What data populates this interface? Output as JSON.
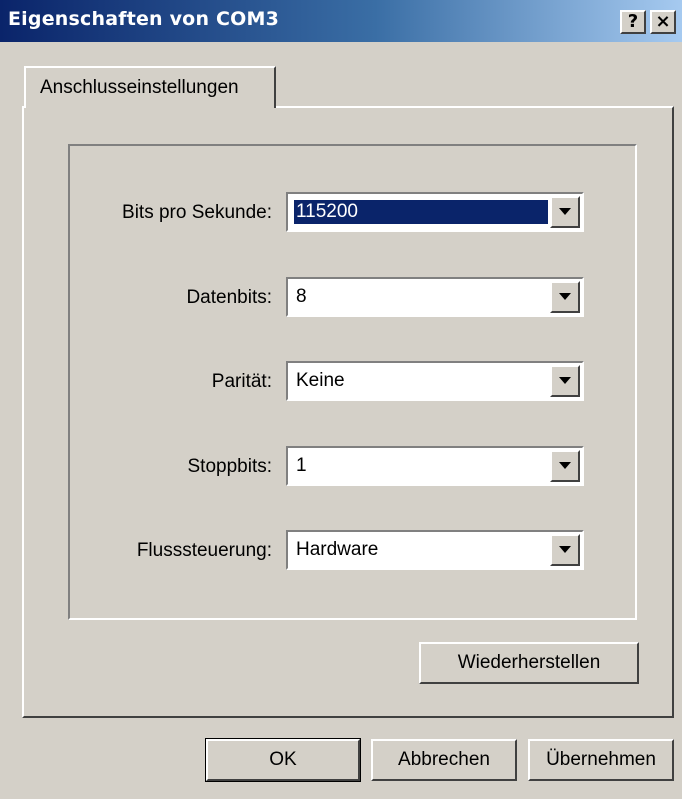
{
  "window": {
    "title": "Eigenschaften von COM3",
    "help_label": "?",
    "close_label": "×"
  },
  "tabs": [
    {
      "label": "Anschlusseinstellungen",
      "selected": true
    }
  ],
  "settings": [
    {
      "label": "Bits pro Sekunde:",
      "value": "115200",
      "focused": true
    },
    {
      "label": "Datenbits:",
      "value": "8"
    },
    {
      "label": "Parität:",
      "value": "Keine"
    },
    {
      "label": "Stoppbits:",
      "value": "1"
    },
    {
      "label": "Flusssteuerung:",
      "value": "Hardware"
    }
  ],
  "restore_button": "Wiederherstellen",
  "footer": {
    "ok": "OK",
    "cancel": "Abbrechen",
    "apply": "Übernehmen"
  },
  "colors": {
    "title_gradient_start": "#0a246a",
    "title_gradient_end": "#a6caf0",
    "face": "#d4d0c8",
    "selection": "#0a246a"
  }
}
